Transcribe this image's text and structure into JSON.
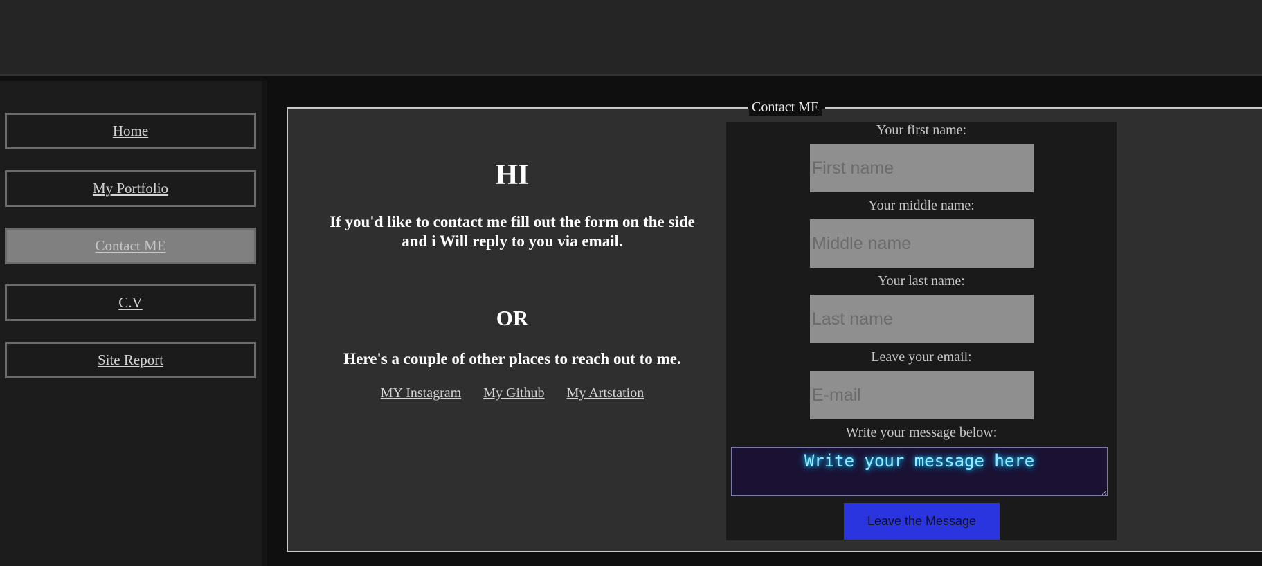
{
  "nav": {
    "items": [
      {
        "label": "Home",
        "active": false
      },
      {
        "label": "My Portfolio",
        "active": false
      },
      {
        "label": "Contact ME",
        "active": true
      },
      {
        "label": "C.V",
        "active": false
      },
      {
        "label": "Site Report",
        "active": false
      }
    ]
  },
  "main": {
    "legend": "Contact ME",
    "greeting": "HI",
    "intro": "If you'd like to contact me fill out the form on the side and i Will reply to you via email.",
    "or": "OR",
    "other_places": "Here's a couple of other places to reach out to me.",
    "links": [
      "MY Instagram",
      "My Github",
      "My Artstation"
    ]
  },
  "form": {
    "first_name_label": "Your first name:",
    "first_name_placeholder": "First name",
    "middle_name_label": "Your middle name:",
    "middle_name_placeholder": "Middle name",
    "last_name_label": "Your last name:",
    "last_name_placeholder": "Last name",
    "email_label": "Leave your email:",
    "email_placeholder": "E-mail",
    "message_label": "Write your message below:",
    "message_placeholder": "Write your message here",
    "submit_label": "Leave the Message"
  },
  "colors": {
    "header_bg": "#252525",
    "sidebar_bg": "#1c1c1c",
    "active_nav_bg": "#808080",
    "fieldset_bg": "#2f2f2f",
    "form_bg": "#1a1a1a",
    "input_bg": "#8f8f8f",
    "submit_bg": "#2a35e0",
    "message_bg": "#1a1133",
    "message_glow": "#00bfff"
  }
}
